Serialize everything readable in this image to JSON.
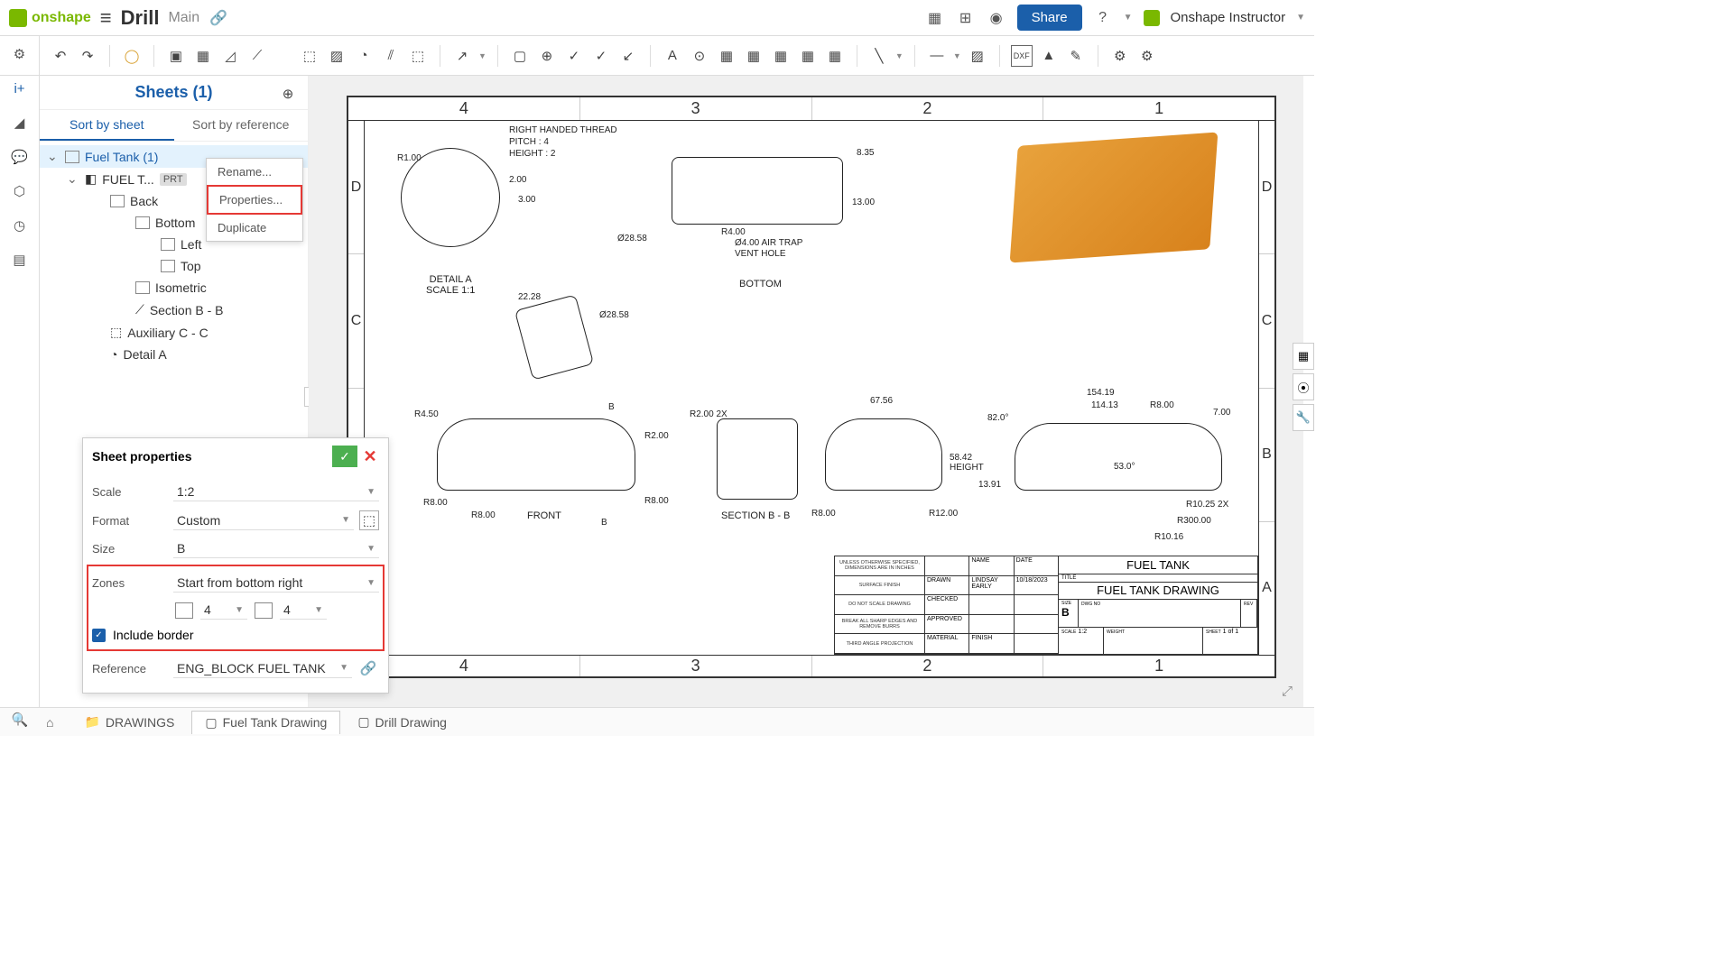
{
  "header": {
    "app": "onshape",
    "doc_title": "Drill",
    "doc_sub": "Main",
    "share": "Share",
    "user": "Onshape Instructor"
  },
  "sidebar": {
    "title": "Sheets (1)",
    "sort_tabs": [
      "Sort by sheet",
      "Sort by reference"
    ],
    "tree": {
      "root": "Fuel Tank (1)",
      "part": "FUEL T...",
      "part_badge": "PRT",
      "views": [
        "Back",
        "Bottom",
        "Left",
        "Top",
        "Isometric",
        "Section B - B",
        "Auxiliary C - C",
        "Detail A"
      ]
    }
  },
  "context_menu": {
    "items": [
      "Rename...",
      "Properties...",
      "Duplicate"
    ]
  },
  "props": {
    "title": "Sheet properties",
    "rows": {
      "scale_label": "Scale",
      "scale_value": "1:2",
      "format_label": "Format",
      "format_value": "Custom",
      "size_label": "Size",
      "size_value": "B",
      "zones_label": "Zones",
      "zones_value": "Start from bottom right",
      "zone_cols": "4",
      "zone_rows": "4",
      "include_border": "Include border",
      "reference_label": "Reference",
      "reference_value": "ENG_BLOCK FUEL TANK"
    }
  },
  "drawing": {
    "cols": [
      "4",
      "3",
      "2",
      "1"
    ],
    "rows": [
      "D",
      "C",
      "B",
      "A"
    ],
    "notes": {
      "thread": "RIGHT HANDED THREAD",
      "pitch": "PITCH : 4",
      "height": "HEIGHT : 2",
      "detail_a": "DETAIL A",
      "detail_scale": "SCALE 1:1",
      "bottom_label": "BOTTOM",
      "front_label": "FRONT",
      "section_label": "SECTION B - B",
      "airtrap1": "Ø4.00 AIR TRAP",
      "airtrap2": "VENT HOLE",
      "height_dim": "58.42\nHEIGHT"
    },
    "dims": {
      "r1": "R1.00",
      "d2": "2.00",
      "d3": "3.00",
      "d835": "8.35",
      "d13": "13.00",
      "d2858a": "Ø28.58",
      "d2858b": "Ø28.58",
      "d2228": "22.28",
      "r4": "R4.00",
      "r45": "R4.50",
      "r8a": "R8.00",
      "r8b": "R8.00",
      "r8c": "R8.00",
      "r8d": "R8.00",
      "r2": "R2.00",
      "r2x": "R2.00 2X",
      "r12": "R12.00",
      "d6756": "67.56",
      "d15419": "154.19",
      "d11413": "114.13",
      "r8e": "R8.00",
      "d7": "7.00",
      "a82": "82.0°",
      "a53": "53.0°",
      "d1391": "13.91",
      "r1025": "R10.25 2X",
      "r300": "R300.00",
      "r1016": "R10.16",
      "lb": "B"
    },
    "title_block": {
      "unless": "UNLESS OTHERWISE SPECIFIED, DIMENSIONS ARE IN INCHES",
      "donot": "DO NOT SCALE DRAWING",
      "break": "BREAK ALL SHARP EDGES AND REMOVE BURRS",
      "third": "THIRD ANGLE PROJECTION",
      "surface": "SURFACE FINISH",
      "drawn": "DRAWN",
      "checked": "CHECKED",
      "approved": "APPROVED",
      "name": "NAME",
      "date": "DATE",
      "name_val": "LINDSAY EARLY",
      "date_val": "10/18/2023",
      "material": "MATERIAL",
      "finish": "FINISH",
      "title": "FUEL TANK",
      "subtitle": "FUEL TANK DRAWING",
      "size_lbl": "SIZE",
      "size": "B",
      "dwg": "DWG NO",
      "rev": "REV",
      "scale_lbl": "SCALE",
      "scale": "1:2",
      "weight": "WEIGHT",
      "sheet_lbl": "SHEET",
      "sheet": "1 of 1",
      "title_lbl": "TITLE"
    }
  },
  "tabs": {
    "drawings": "DRAWINGS",
    "fuel": "Fuel Tank Drawing",
    "drill": "Drill Drawing"
  }
}
